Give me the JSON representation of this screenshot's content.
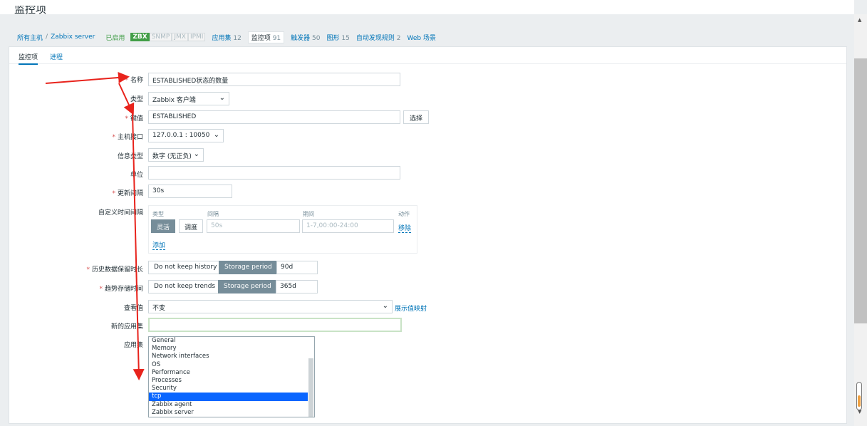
{
  "page": {
    "title": "监控项"
  },
  "nav": {
    "all_hosts": "所有主机",
    "sep": "/",
    "host": "Zabbix server",
    "status": "已启用",
    "zbx": "ZBX",
    "snmp": "SNMP",
    "jmx": "JMX",
    "ipmi": "IPMI",
    "applications": "应用集",
    "applications_count": "12",
    "items": "监控项",
    "items_count": "91",
    "triggers": "触发器",
    "triggers_count": "50",
    "graphs": "图形",
    "graphs_count": "15",
    "discovery": "自动发现规则",
    "discovery_count": "2",
    "web": "Web 场景"
  },
  "tabs": {
    "items": "监控项",
    "process": "进程"
  },
  "form": {
    "name_label": "名称",
    "name_value": "ESTABLISHED状态的数量",
    "type_label": "类型",
    "type_value": "Zabbix 客户端",
    "key_label": "键值",
    "key_value": "ESTABLISHED",
    "select_btn": "选择",
    "iface_label": "主机接口",
    "iface_value": "127.0.0.1 : 10050",
    "info_label": "信息类型",
    "info_value": "数字 (无正负)",
    "unit_label": "单位",
    "unit_value": "",
    "interval_label": "更新间隔",
    "interval_value": "30s",
    "custom_label": "自定义时间间隔",
    "custom": {
      "h_type": "类型",
      "h_interval": "间隔",
      "h_period": "期间",
      "h_action": "动作",
      "flexible": "灵活",
      "scheduling": "调度",
      "interval_ph": "50s",
      "period_ph": "1-7,00:00-24:00",
      "remove": "移除",
      "add": "添加"
    },
    "history_label": "历史数据保留时长",
    "history_nokeep": "Do not keep history",
    "history_storage": "Storage period",
    "history_value": "90d",
    "trends_label": "趋势存储时间",
    "trends_nokeep": "Do not keep trends",
    "trends_storage": "Storage period",
    "trends_value": "365d",
    "valuemap_label": "查看值",
    "valuemap_value": "不变",
    "valuemap_link": "展示值映射",
    "newapp_label": "新的应用集",
    "apps_label": "应用集",
    "apps": [
      "General",
      "Memory",
      "Network interfaces",
      "OS",
      "Performance",
      "Processes",
      "Security",
      "tcp",
      "Zabbix agent",
      "Zabbix server"
    ],
    "apps_selected": "tcp"
  },
  "colors": {
    "accent": "#0275b8",
    "enabled": "#429e47",
    "required": "#d64e4e",
    "arrow": "#e8231c",
    "list_selected": "#0a66ff"
  }
}
